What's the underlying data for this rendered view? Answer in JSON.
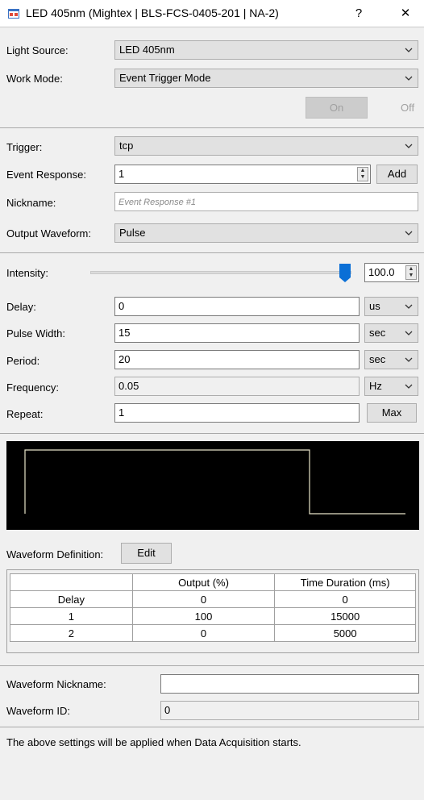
{
  "window": {
    "title": "LED 405nm (Mightex | BLS-FCS-0405-201 | NA-2)",
    "help_label": "?",
    "close_label": "✕"
  },
  "light_source": {
    "label": "Light Source:",
    "value": "LED 405nm"
  },
  "work_mode": {
    "label": "Work Mode:",
    "value": "Event Trigger Mode"
  },
  "on_off": {
    "on_label": "On",
    "off_label": "Off"
  },
  "trigger": {
    "label": "Trigger:",
    "value": "tcp"
  },
  "event_response": {
    "label": "Event Response:",
    "value": "1",
    "add_label": "Add"
  },
  "nickname": {
    "label": "Nickname:",
    "placeholder": "Event Response #1"
  },
  "output_waveform": {
    "label": "Output Waveform:",
    "value": "Pulse"
  },
  "intensity": {
    "label": "Intensity:",
    "value": "100.0",
    "fraction": 1.0
  },
  "delay": {
    "label": "Delay:",
    "value": "0",
    "unit": "us"
  },
  "pulse_width": {
    "label": "Pulse Width:",
    "value": "15",
    "unit": "sec"
  },
  "period": {
    "label": "Period:",
    "value": "20",
    "unit": "sec"
  },
  "frequency": {
    "label": "Frequency:",
    "value": "0.05",
    "unit": "Hz"
  },
  "repeat": {
    "label": "Repeat:",
    "value": "1",
    "max_label": "Max"
  },
  "preview_colors": {
    "background": "#000000",
    "trace": "#e8e4c9"
  },
  "waveform_definition": {
    "label": "Waveform Definition:",
    "edit_label": "Edit",
    "columns": [
      "",
      "Output (%)",
      "Time Duration (ms)"
    ],
    "rows": [
      [
        "Delay",
        "0",
        "0"
      ],
      [
        "1",
        "100",
        "15000"
      ],
      [
        "2",
        "0",
        "5000"
      ]
    ]
  },
  "waveform_nickname": {
    "label": "Waveform Nickname:",
    "value": ""
  },
  "waveform_id": {
    "label": "Waveform ID:",
    "value": "0"
  },
  "footer_note": "The above settings will be applied when Data Acquisition starts."
}
